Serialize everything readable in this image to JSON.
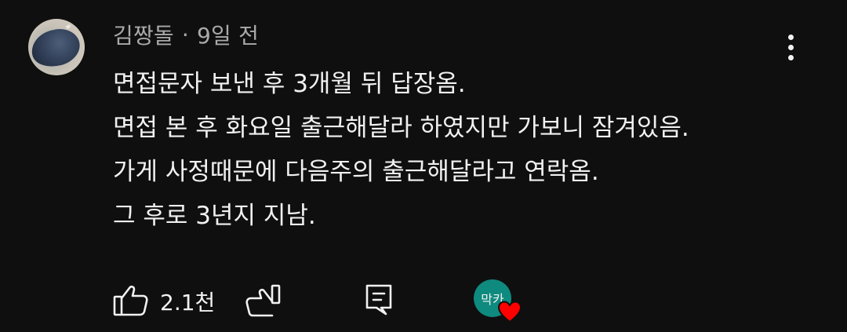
{
  "comment": {
    "author": "김짱돌",
    "separator": "·",
    "time": "9일 전",
    "lines": [
      "면접문자 보낸 후 3개월 뒤 답장옴.",
      "면접 본 후 화요일 출근해달라 하였지만 가보니 잠겨있음.",
      "가게 사정때문에 다음주의 출근해달라고 연락옴.",
      "그 후로 3년지 지남."
    ]
  },
  "actions": {
    "like_count": "2.1천",
    "creator_heart_avatar_text": "막카"
  },
  "colors": {
    "background": "#0f0f0f",
    "text_primary": "#f1f1f1",
    "text_secondary": "#aaaaaa",
    "heart": "#ff0000",
    "creator_avatar": "#0f8a7e"
  },
  "icons": {
    "more": "vertical-ellipsis-icon",
    "like": "thumbs-up-icon",
    "dislike": "thumbs-down-icon",
    "reply": "comment-reply-icon",
    "heart": "heart-icon"
  }
}
